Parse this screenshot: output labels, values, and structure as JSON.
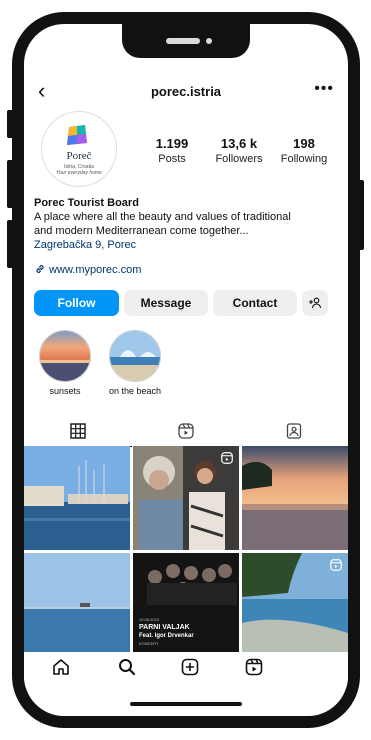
{
  "profile": {
    "username": "porec.istria",
    "logo_name": "Poreč",
    "logo_sub": "Istria, Croatia",
    "logo_slogan": "Your everyday home",
    "display_name": "Porec Tourist Board",
    "bio_line1": "A place where all the beauty and values of traditional",
    "bio_line2": "and modern Mediterranean come together...",
    "address": "Zagrebačka 9, Porec",
    "website": "www.myporec.com"
  },
  "stats": [
    {
      "value": "1.199",
      "label": "Posts"
    },
    {
      "value": "13,6 k",
      "label": "Followers"
    },
    {
      "value": "198",
      "label": "Following"
    }
  ],
  "actions": {
    "follow": "Follow",
    "message": "Message",
    "contact": "Contact",
    "add_person_icon": "add-person-icon"
  },
  "highlights": [
    {
      "label": "sunsets"
    },
    {
      "label": "on the beach"
    }
  ],
  "tabs": [
    "grid-icon",
    "reels-icon",
    "tagged-icon"
  ],
  "posts": [
    {
      "alt": "harbor with sailboats"
    },
    {
      "alt": "two people portrait",
      "reel": true
    },
    {
      "alt": "sunset over sea"
    },
    {
      "alt": "sea horizon"
    },
    {
      "alt": "band concert poster",
      "text1": "PARNI VALJAK",
      "text2": "Feat. Igor Drvenkar",
      "text0": "10.08.2023",
      "text3": "KONCERT"
    },
    {
      "alt": "pine coast",
      "reel": true
    }
  ],
  "nav": [
    "home-icon",
    "search-icon",
    "create-icon",
    "reels-icon"
  ],
  "colors": {
    "accent": "#0095f6",
    "link": "#00376b"
  }
}
